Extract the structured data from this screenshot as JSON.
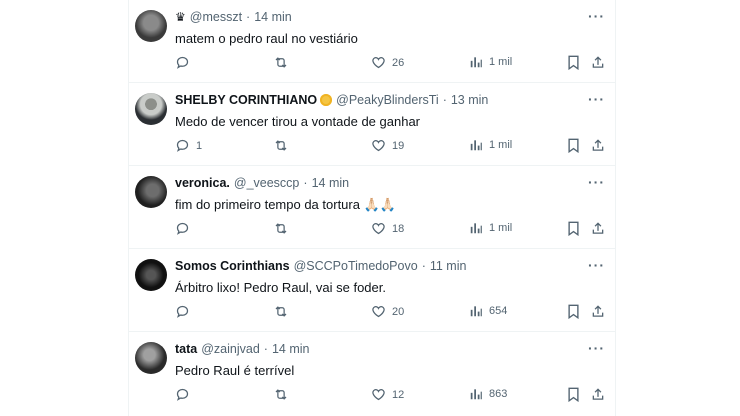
{
  "tweets": [
    {
      "display_name": "",
      "prefix_icon": "crown-icon",
      "handle": "@messzt",
      "time": "14 min",
      "text": "matem o pedro raul no vestiário",
      "replies": "",
      "likes": "26",
      "views": "1 mil",
      "avatar_colors": [
        "#3a3a3a",
        "#8a8a8a"
      ]
    },
    {
      "display_name": "SHELBY CORINTHIANO",
      "badge_icon": "coin-badge-icon",
      "handle": "@PeakyBlindersTi",
      "time": "13 min",
      "text": "Medo de vencer tirou a vontade de ganhar",
      "replies": "1",
      "likes": "19",
      "views": "1 mil",
      "avatar_colors": [
        "#2b2f33",
        "#c9ccc9"
      ]
    },
    {
      "display_name": "veronica.",
      "handle": "@_veesccp",
      "time": "14 min",
      "text": "fim do primeiro tempo da tortura 🙏🏻🙏🏻",
      "replies": "",
      "likes": "18",
      "views": "1 mil",
      "avatar_colors": [
        "#1f1f1f",
        "#6d6d6d"
      ]
    },
    {
      "display_name": "Somos Corinthians",
      "handle": "@SCCPoTimedoPovo",
      "time": "11 min",
      "text": "Árbitro lixo! Pedro Raul, vai se foder.",
      "replies": "",
      "likes": "20",
      "views": "654",
      "avatar_colors": [
        "#111111",
        "#555555"
      ]
    },
    {
      "display_name": "tata",
      "handle": "@zainjvad",
      "time": "14 min",
      "text": "Pedro Raul é terrível",
      "replies": "",
      "likes": "12",
      "views": "863",
      "avatar_colors": [
        "#2a2a2a",
        "#a0a0a0"
      ]
    }
  ],
  "ui": {
    "dot": "·",
    "more": "···"
  }
}
